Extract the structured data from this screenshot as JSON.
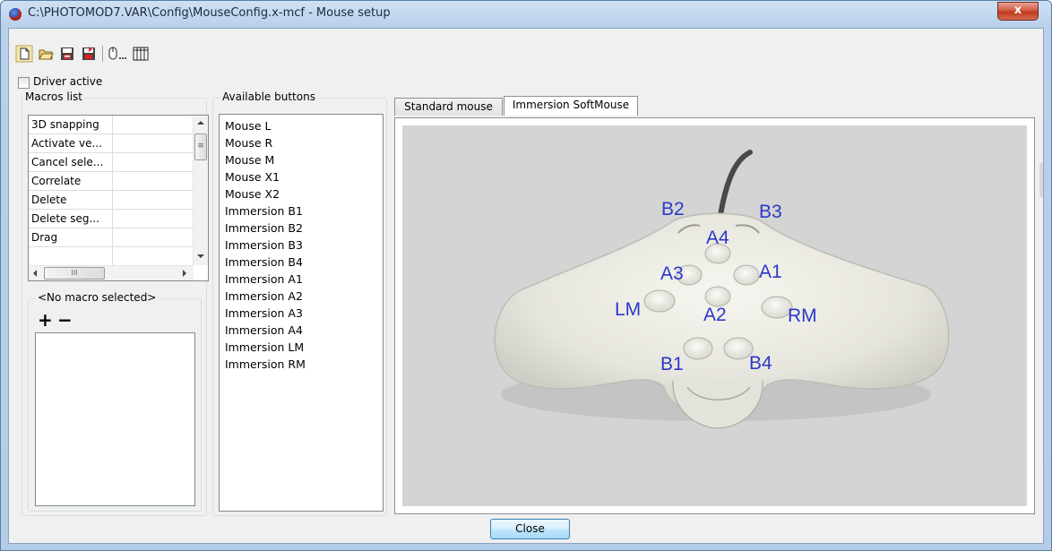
{
  "window": {
    "title": "C:\\PHOTOMOD7.VAR\\Config\\MouseConfig.x-mcf - Mouse setup",
    "close_glyph": "x"
  },
  "toolbar": {
    "icons": [
      "new-file-icon",
      "open-folder-icon",
      "save-icon",
      "save-as-icon",
      "mouse-settings-icon",
      "grid-icon"
    ]
  },
  "driver_active": {
    "label": "Driver active",
    "checked": false
  },
  "macros": {
    "title": "Macros list",
    "items": [
      "3D snapping",
      "Activate ve...",
      "Cancel sele...",
      "Correlate",
      "Delete",
      "Delete seg...",
      "Drag"
    ],
    "scroll_h_glyph": "III",
    "scroll_v_glyph": "≡"
  },
  "macro_editor": {
    "title": "<No macro selected>",
    "add_label": "+",
    "remove_label": "−"
  },
  "available_buttons": {
    "title": "Available buttons",
    "items": [
      "Mouse L",
      "Mouse R",
      "Mouse M",
      "Mouse X1",
      "Mouse X2",
      "Immersion B1",
      "Immersion B2",
      "Immersion B3",
      "Immersion B4",
      "Immersion A1",
      "Immersion A2",
      "Immersion A3",
      "Immersion A4",
      "Immersion LM",
      "Immersion RM"
    ]
  },
  "tabs": [
    {
      "label": "Standard mouse",
      "active": false
    },
    {
      "label": "Immersion SoftMouse",
      "active": true
    }
  ],
  "mouse_labels": {
    "b2": "B2",
    "b3": "B3",
    "a4": "A4",
    "a3": "A3",
    "a1": "A1",
    "lm": "LM",
    "a2": "A2",
    "rm": "RM",
    "b1": "B1",
    "b4": "B4"
  },
  "footer": {
    "close_label": "Close"
  },
  "colors": {
    "label_blue": "#2b38c9",
    "mouse_body": "#e8e7e0",
    "canvas_bg": "#d4d4d4"
  }
}
